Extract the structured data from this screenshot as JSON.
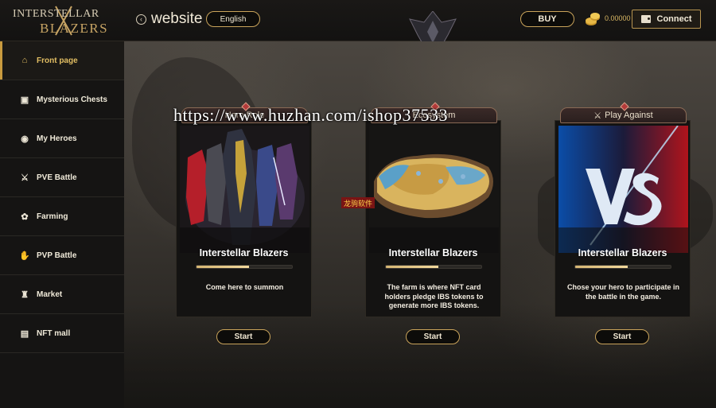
{
  "header": {
    "logo_line1": "INTERSTELLAR",
    "logo_line2": "BLAZERS",
    "website_label": "website",
    "language": "English",
    "buy_label": "BUY",
    "balance": "0.00000",
    "connect_label": "Connect"
  },
  "sidebar": {
    "items": [
      {
        "label": "Front page",
        "icon": "home-icon",
        "active": true
      },
      {
        "label": "Mysterious Chests",
        "icon": "chest-icon",
        "active": false
      },
      {
        "label": "My Heroes",
        "icon": "trophy-icon",
        "active": false
      },
      {
        "label": "PVE Battle",
        "icon": "crossed-swords-icon",
        "active": false
      },
      {
        "label": "Farming",
        "icon": "coins-hand-icon",
        "active": false
      },
      {
        "label": "PVP Battle",
        "icon": "fist-icon",
        "active": false
      },
      {
        "label": "Market",
        "icon": "store-icon",
        "active": false
      },
      {
        "label": "NFT mall",
        "icon": "shop-icon",
        "active": false
      }
    ]
  },
  "cards": [
    {
      "tab_label": "Hero Role",
      "title": "Interstellar Blazers",
      "progress": 0.55,
      "description": "Come here to summon",
      "button_label": "Start"
    },
    {
      "tab_label": "Ecosystem",
      "title": "Interstellar Blazers",
      "progress": 0.55,
      "description": "The farm is where NFT card holders pledge IBS tokens to generate more IBS tokens.",
      "button_label": "Start"
    },
    {
      "tab_label": "Play Against",
      "title": "Interstellar Blazers",
      "progress": 0.55,
      "description": "Chose your hero to participate in the battle in the game.",
      "button_label": "Start"
    }
  ],
  "overlay": {
    "watermark": "https://www.huzhan.com/ishop37533",
    "stamp": "龙驹软件"
  },
  "colors": {
    "accent_gold": "#c9a35a",
    "active_nav": "#e2be63",
    "sidebar_bg": "#151413"
  }
}
